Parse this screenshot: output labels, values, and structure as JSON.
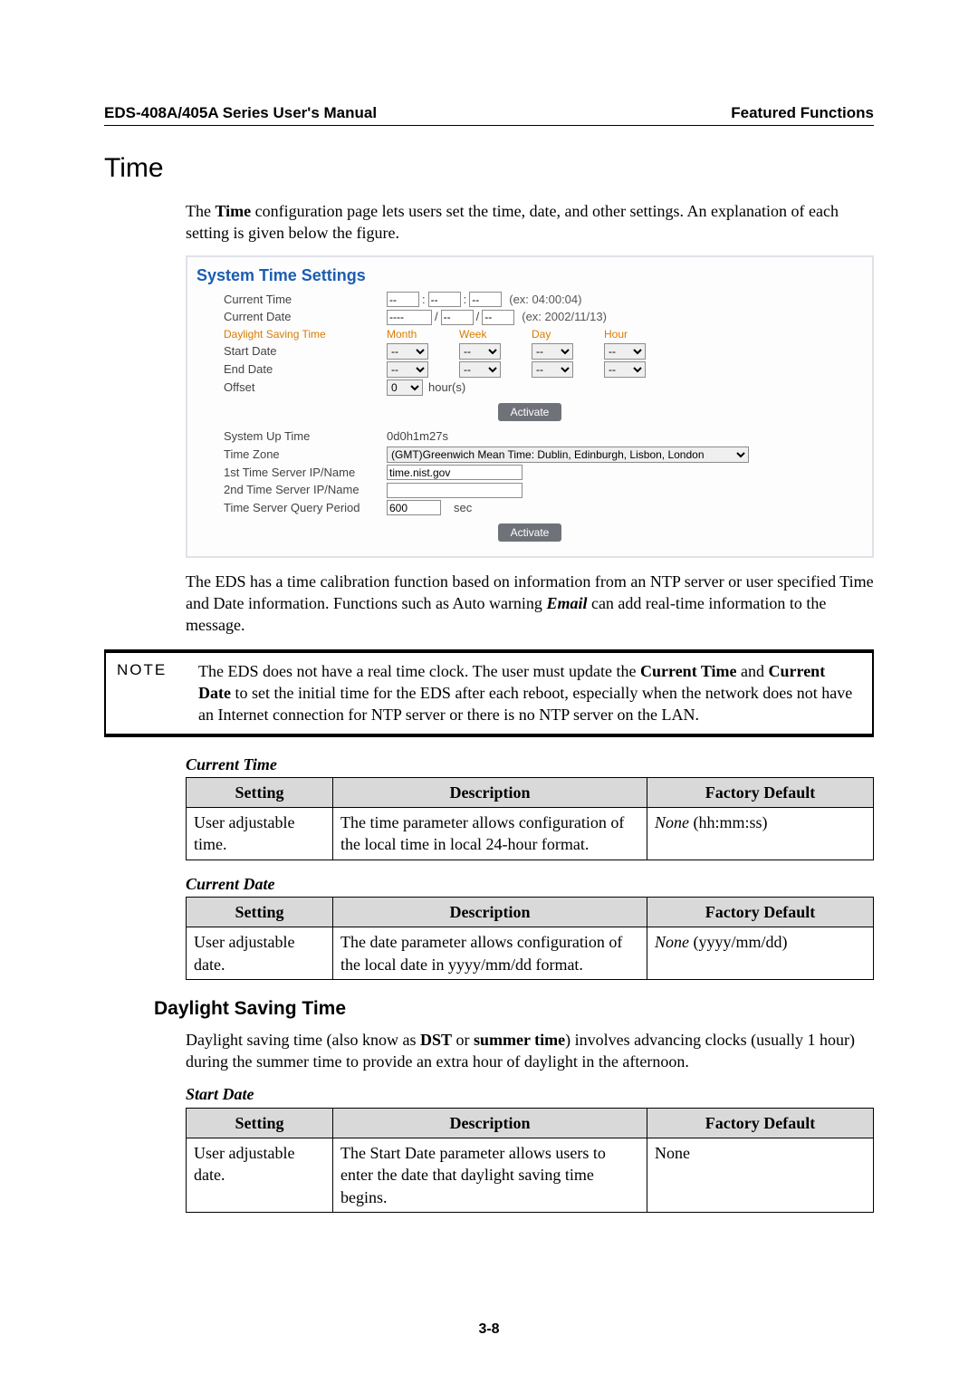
{
  "header": {
    "left": "EDS-408A/405A Series User's Manual",
    "right": "Featured Functions"
  },
  "section_title": "Time",
  "intro": {
    "pre": "The ",
    "b1": "Time",
    "post": " configuration page lets users set the time, date, and other settings. An explanation of each setting is given below the figure."
  },
  "shot": {
    "title": "System Time Settings",
    "labels": {
      "cur_time": "Current Time",
      "cur_date": "Current Date",
      "dst": "Daylight Saving Time",
      "start": "Start Date",
      "end": "End Date",
      "offset": "Offset",
      "up": "System Up Time",
      "tz": "Time Zone",
      "s1": "1st Time Server IP/Name",
      "s2": "2nd Time Server IP/Name",
      "qp": "Time Server Query Period"
    },
    "dst_heads": {
      "m": "Month",
      "w": "Week",
      "d": "Day",
      "h": "Hour"
    },
    "vals": {
      "tH": "--",
      "tM": "--",
      "tS": "--",
      "tHint": "(ex: 04:00:04)",
      "dY": "----",
      "dM": "--",
      "dD": "--",
      "dHint": "(ex: 2002/11/13)",
      "sel": "--",
      "offset": "0",
      "offset_unit": "hour(s)",
      "activate": "Activate",
      "uptime": "0d0h1m27s",
      "tz": "(GMT)Greenwich Mean Time: Dublin, Edinburgh, Lisbon, London",
      "s1": "time.nist.gov",
      "s2": "",
      "qp": "600",
      "sec": "sec"
    }
  },
  "p2": {
    "pre": "The EDS has a time calibration function based on information from an NTP server or user specified Time and Date information. Functions such as Auto warning ",
    "bi": "Email",
    "post": " can add real-time information to the message."
  },
  "note": {
    "label": "NOTE",
    "t1": "The EDS does not have a real time clock. The user must update the ",
    "b1": "Current Time",
    "t2": " and ",
    "b2": "Current Date",
    "t3": " to set the initial time for the EDS after each reboot, especially when the network does not have an Internet connection for NTP server or there is no NTP server on the LAN."
  },
  "tables": {
    "headers": {
      "setting": "Setting",
      "desc": "Description",
      "def": "Factory Default"
    },
    "cur_time": {
      "title": "Current Time",
      "setting": "User adjustable time.",
      "desc": "The time parameter allows configuration of the local time in local 24-hour format.",
      "def_i": "None",
      "def_rest": " (hh:mm:ss)"
    },
    "cur_date": {
      "title": "Current Date",
      "setting": "User adjustable date.",
      "desc": "The date parameter allows configuration of the local date in yyyy/mm/dd format.",
      "def_i": "None",
      "def_rest": " (yyyy/mm/dd)"
    },
    "start_date": {
      "title": "Start Date",
      "setting": "User adjustable date.",
      "desc": "The Start Date parameter allows users to enter the date that daylight saving time begins.",
      "def": "None"
    }
  },
  "dst_heading": "Daylight Saving Time",
  "dst_para": {
    "t1": "Daylight saving time (also know as ",
    "b1": "DST",
    "t2": " or ",
    "b2": "summer time",
    "t3": ") involves advancing clocks (usually 1 hour) during the summer time to provide an extra hour of daylight in the afternoon."
  },
  "page_num": "3-8"
}
